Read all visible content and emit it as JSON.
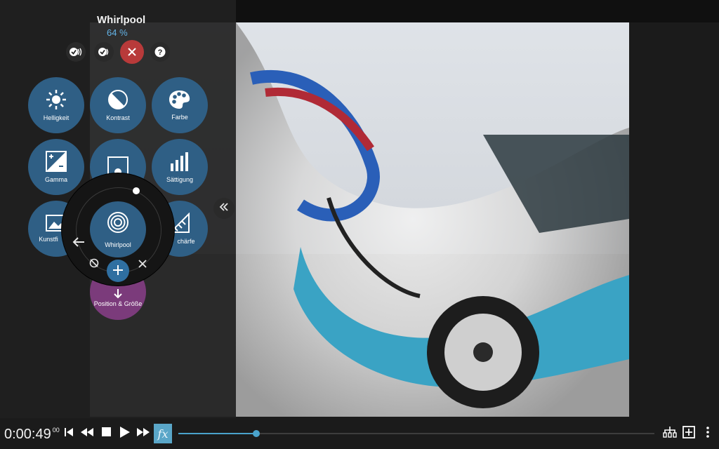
{
  "effect": {
    "title": "Whirlpool",
    "percent": "64 %"
  },
  "tool_buttons": [
    {
      "label": "Helligkeit"
    },
    {
      "label": "Kontrast"
    },
    {
      "label": "Farbe"
    },
    {
      "label": "Gamma"
    },
    {
      "label": "Sättigung"
    },
    {
      "label": "Kunstfi"
    },
    {
      "label": "chärfe"
    },
    {
      "label": "Position & Größe"
    }
  ],
  "wheel": {
    "center_label": "Whirlpool"
  },
  "playback": {
    "time": "0:00:49",
    "time_ms": "00",
    "fx_label": "fx",
    "progress": 0.164
  },
  "colors": {
    "tool_blue": "#2f5f85",
    "accent_blue": "#4aa3cc",
    "cancel_red": "#b83a3a",
    "position_purple": "#7b3b7b"
  },
  "icons": {
    "top": [
      "double-check-icon",
      "check-icon",
      "close-icon",
      "help-icon"
    ],
    "wheel": [
      "back-arrow-icon",
      "reset-icon",
      "add-icon",
      "close-icon"
    ],
    "bottom": [
      "skip-back-icon",
      "rewind-icon",
      "stop-icon",
      "play-icon",
      "fast-forward-icon",
      "fx-icon",
      "hierarchy-icon",
      "add-frame-icon",
      "more-icon"
    ]
  }
}
